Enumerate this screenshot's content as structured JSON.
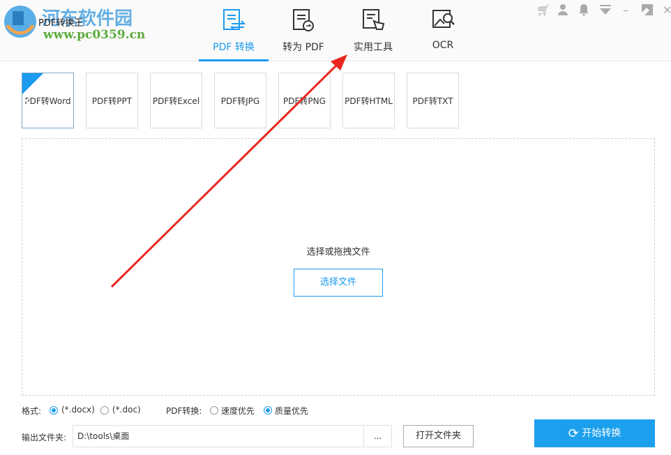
{
  "watermark": {
    "name": "河东软件园",
    "url": "www.pc0359.cn"
  },
  "app_title": "PDF转换王",
  "tabs": [
    {
      "label": "PDF 转换",
      "active": true
    },
    {
      "label": "转为 PDF"
    },
    {
      "label": "实用工具"
    },
    {
      "label": "OCR"
    }
  ],
  "window_controls": {
    "cart": "cart-icon",
    "user": "user-icon",
    "bell": "bell-icon",
    "menu": "menu-icon",
    "minimize": "–",
    "maximize": "maximize-icon",
    "close": "✕"
  },
  "formats": [
    {
      "label": "PDF转Word",
      "selected": true
    },
    {
      "label": "PDF转PPT"
    },
    {
      "label": "PDF转Excel"
    },
    {
      "label": "PDF转JPG"
    },
    {
      "label": "PDF转PNG"
    },
    {
      "label": "PDF转HTML"
    },
    {
      "label": "PDF转TXT"
    }
  ],
  "drop": {
    "text": "选择或拖拽文件",
    "button": "选择文件"
  },
  "options": {
    "format_label": "格式:",
    "docx": "(*.docx)",
    "doc": "(*.doc)",
    "convert_label": "PDF转换:",
    "speed": "速度优先",
    "quality": "质量优先"
  },
  "output": {
    "label": "输出文件夹:",
    "path": "D:\\tools\\桌面",
    "browse": "...",
    "open": "打开文件夹"
  },
  "start": "开始转换",
  "colors": {
    "accent": "#1a9bf0",
    "arrow": "#e8261f"
  }
}
